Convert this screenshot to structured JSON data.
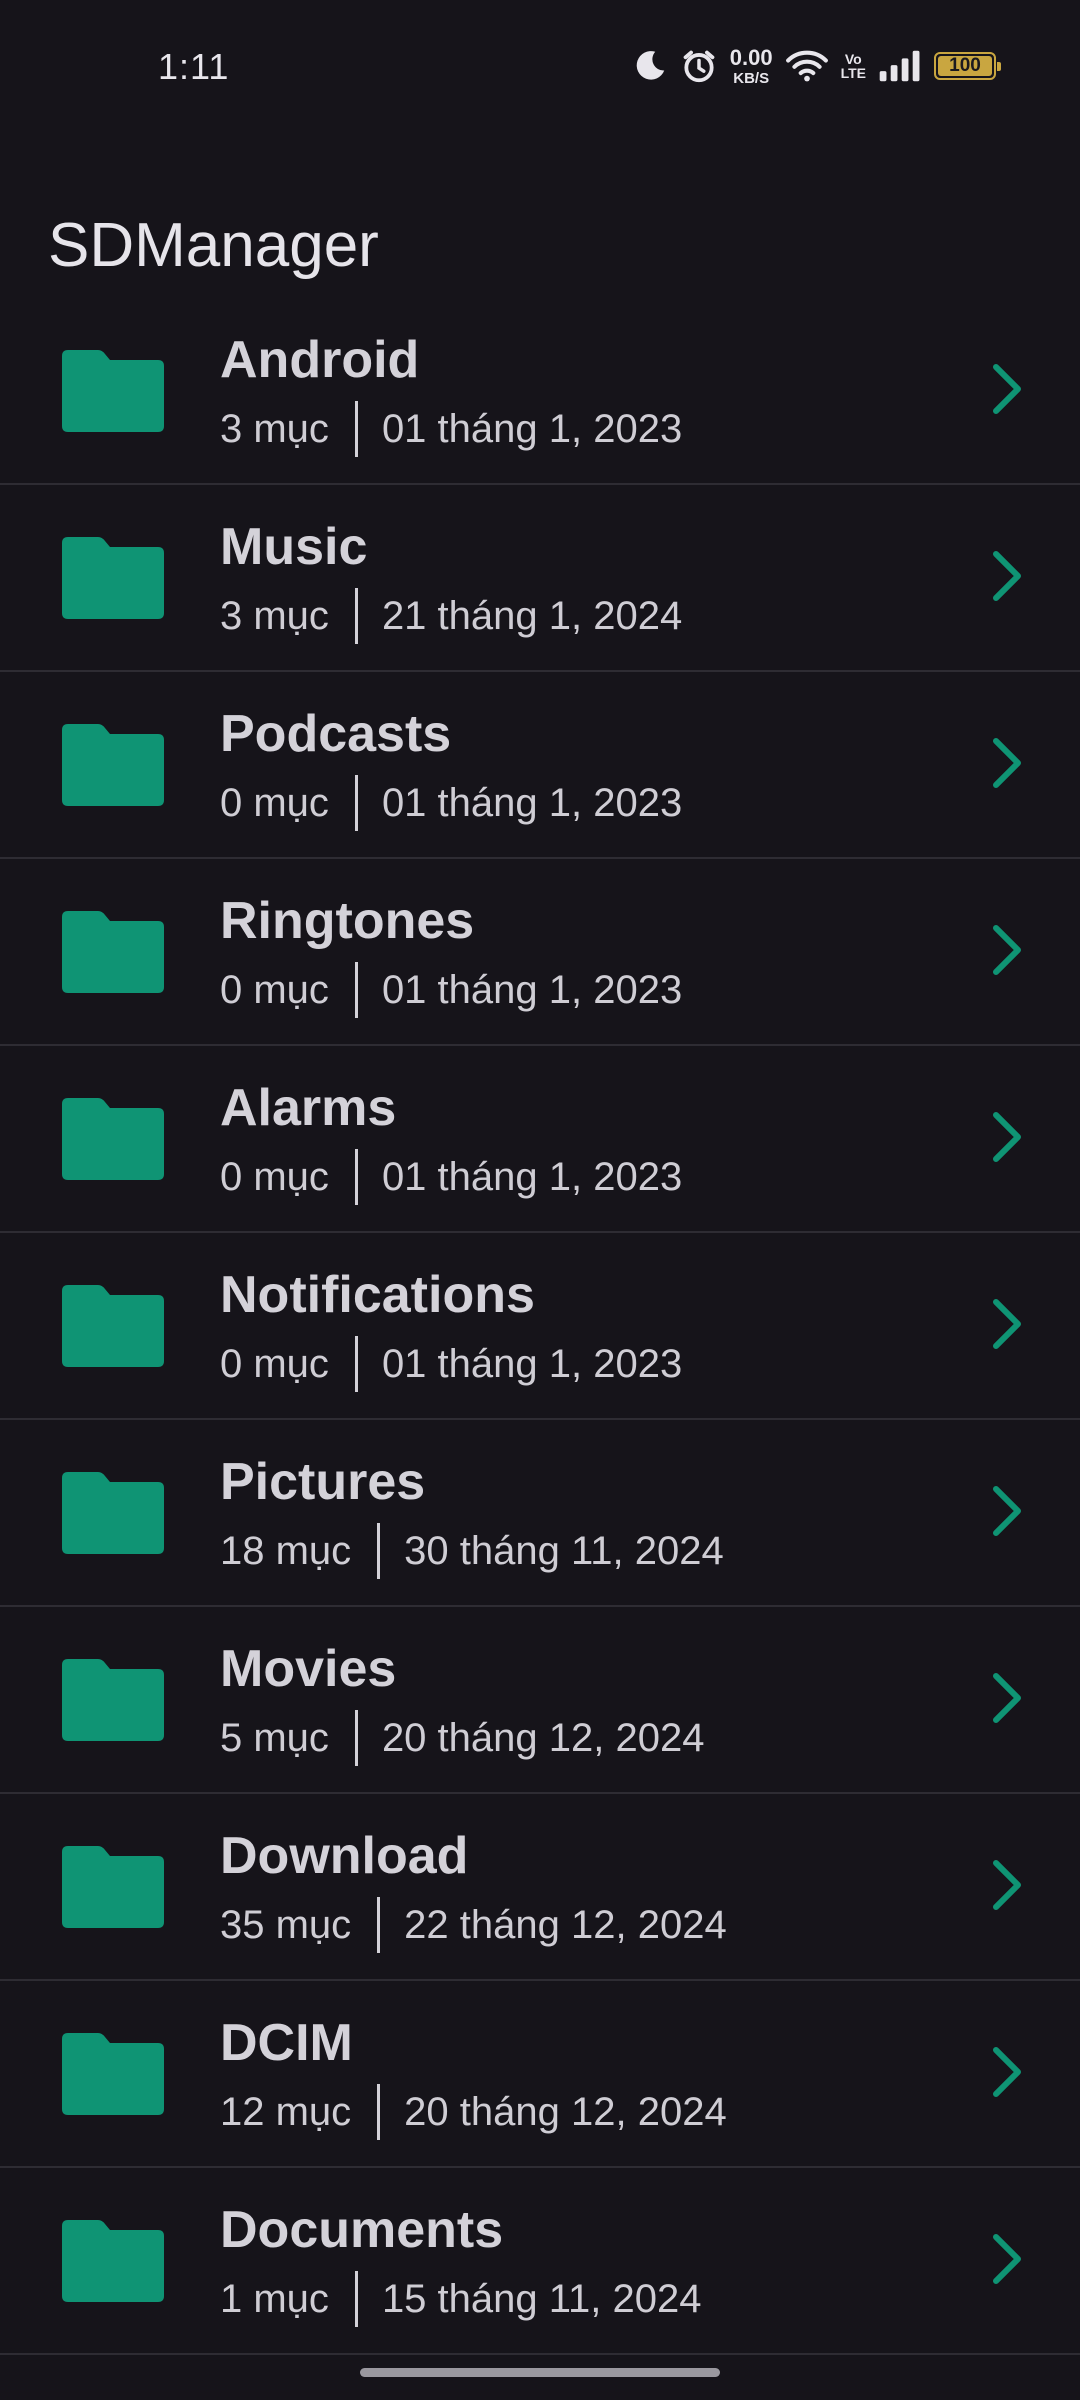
{
  "status_bar": {
    "time": "1:11",
    "net_speed_value": "0.00",
    "net_speed_unit": "KB/S",
    "volte_top": "Vo",
    "volte_bottom": "LTE",
    "battery_level": "100",
    "icons": [
      "moon-icon",
      "alarm-icon",
      "wifi-icon",
      "signal-icon",
      "battery-icon"
    ]
  },
  "app": {
    "title": "SDManager"
  },
  "colors": {
    "background": "#16141a",
    "folder_accent": "#0f9474",
    "divider": "#2e2c33",
    "battery": "#c9a640"
  },
  "folders": [
    {
      "name": "Android",
      "count": "3 mục",
      "date": "01 tháng 1, 2023"
    },
    {
      "name": "Music",
      "count": "3 mục",
      "date": "21 tháng 1, 2024"
    },
    {
      "name": "Podcasts",
      "count": "0 mục",
      "date": "01 tháng 1, 2023"
    },
    {
      "name": "Ringtones",
      "count": "0 mục",
      "date": "01 tháng 1, 2023"
    },
    {
      "name": "Alarms",
      "count": "0 mục",
      "date": "01 tháng 1, 2023"
    },
    {
      "name": "Notifications",
      "count": "0 mục",
      "date": "01 tháng 1, 2023"
    },
    {
      "name": "Pictures",
      "count": "18 mục",
      "date": "30 tháng 11, 2024"
    },
    {
      "name": "Movies",
      "count": "5 mục",
      "date": "20 tháng 12, 2024"
    },
    {
      "name": "Download",
      "count": "35 mục",
      "date": "22 tháng 12, 2024"
    },
    {
      "name": "DCIM",
      "count": "12 mục",
      "date": "20 tháng 12, 2024"
    },
    {
      "name": "Documents",
      "count": "1 mục",
      "date": "15 tháng 11, 2024"
    }
  ]
}
